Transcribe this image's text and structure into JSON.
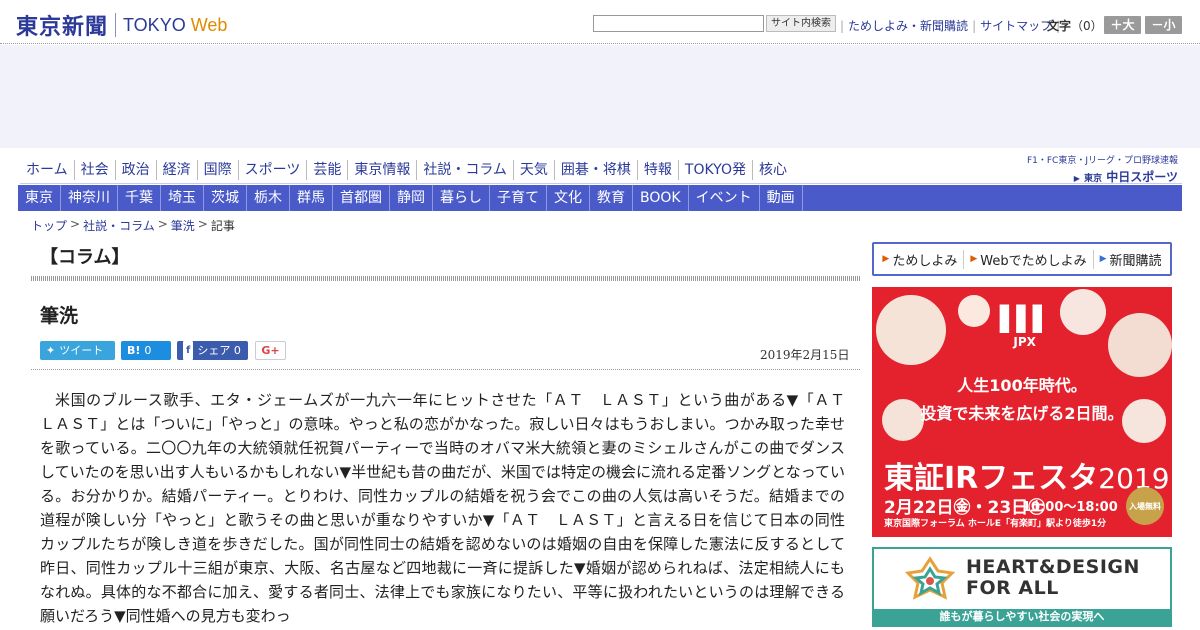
{
  "header": {
    "logo_jp": "東京新聞",
    "logo_en": "TOKYO",
    "logo_web": "Web",
    "search_placeholder": "",
    "search_button": "サイト内検索",
    "links": [
      "ためしよみ・新聞購読",
      "サイトマップ"
    ],
    "text_size_label": "文字",
    "text_size_value": "（0）",
    "bigger": "＋大",
    "smaller": "－小"
  },
  "nav_main": [
    "ホーム",
    "社会",
    "政治",
    "経済",
    "国際",
    "スポーツ",
    "芸能",
    "東京情報",
    "社説・コラム",
    "天気",
    "囲碁・将棋",
    "特報",
    "TOKYO発",
    "核心"
  ],
  "nav_regional": [
    "東京",
    "神奈川",
    "千葉",
    "埼玉",
    "茨城",
    "栃木",
    "群馬",
    "首都圏",
    "静岡",
    "暮らし",
    "子育て",
    "文化",
    "教育",
    "BOOK",
    "イベント",
    "動画"
  ],
  "sports": {
    "sub": "F1・FC東京・Jリーグ・プロ野球速報",
    "prefix": "東京",
    "main": "中日スポーツ"
  },
  "breadcrumb": [
    "トップ",
    "社説・コラム",
    "筆洗",
    "記事"
  ],
  "article": {
    "category": "【コラム】",
    "title": "筆洗",
    "date": "2019年2月15日",
    "share": {
      "tweet": "ツイート",
      "hatena_count": "0",
      "facebook": "シェア",
      "facebook_count": "0",
      "gplus": "G+"
    },
    "body": "米国のブルース歌手、エタ・ジェームズが一九六一年にヒットさせた「ＡＴ　ＬＡＳＴ」という曲がある▼「ＡＴ　ＬＡＳＴ」とは「ついに」「やっと」の意味。やっと私の恋がかなった。寂しい日々はもうおしまい。つかみ取った幸せを歌っている。二〇〇九年の大統領就任祝賀パーティーで当時のオバマ米大統領と妻のミシェルさんがこの曲でダンスしていたのを思い出す人もいるかもしれない▼半世紀も昔の曲だが、米国では特定の機会に流れる定番ソングとなっている。お分かりか。結婚パーティー。とりわけ、同性カップルの結婚を祝う会でこの曲の人気は高いそうだ。結婚までの道程が険しい分「やっと」と歌うその曲と思いが重なりやすいか▼「ＡＴ　ＬＡＳＴ」と言える日を信じて日本の同性カップルたちが険しき道を歩きだした。国が同性同士の結婚を認めないのは婚姻の自由を保障した憲法に反するとして昨日、同性カップル十三組が東京、大阪、名古屋など四地裁に一斉に提訴した▼婚姻が認められねば、法定相続人にもなれぬ。具体的な不都合に加え、愛する者同士、法律上でも家族になりたい、平等に扱われたいというのは理解できる願いだろう▼同性婚への見方も変わっ"
  },
  "sidebar": {
    "subscribe": [
      "ためしよみ",
      "Webでためしよみ",
      "新聞購読"
    ],
    "ad1": {
      "logo": "JPX",
      "copy1": "人生100年時代。",
      "copy2": "投資で未来を広げる2日間。",
      "fest": "東証IRフェスタ",
      "year": "2019",
      "date": "2月22日㊎・23日㊏",
      "time": "10:00～18:00",
      "venue": "東京国際フォーラム ホールE「有楽町」駅より徒歩1分",
      "free": "入場無料"
    },
    "ad2": {
      "title1": "HEART&DESIGN",
      "title2": "FOR ALL",
      "foot": "誰もが暮らしやすい社会の実現へ"
    }
  }
}
